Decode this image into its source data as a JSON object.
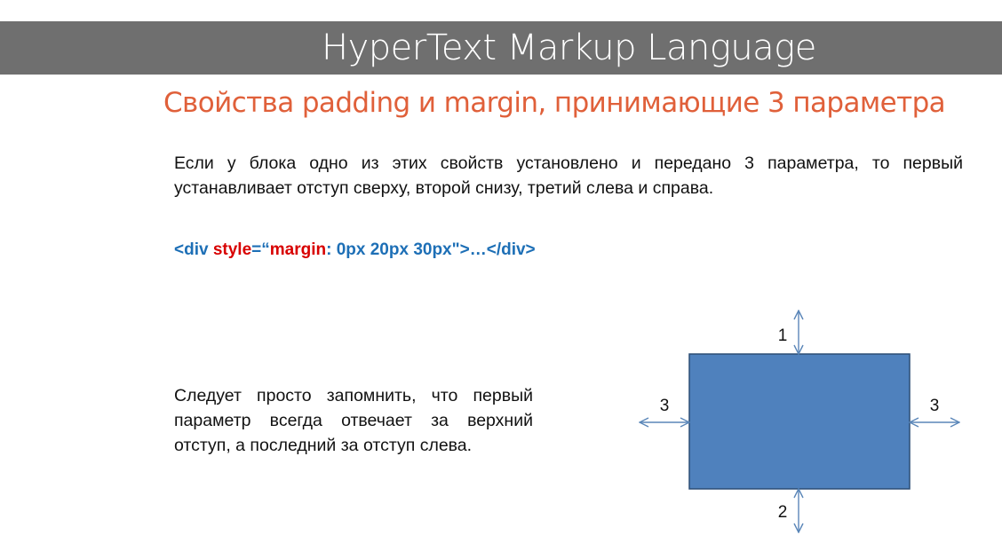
{
  "header": {
    "title": "HyperText Markup Language"
  },
  "slide": {
    "subtitle": "Свойства padding и margin, принимающие 3 параметра",
    "paragraph1": "Если у блока одно из этих свойств установлено и передано 3 параметра, то первый устанавливает отступ сверху, второй снизу, третий слева и справа.",
    "code": {
      "open_tag": "<div ",
      "attr": "style",
      "eq_quote": "=“",
      "prop": "margin",
      "value": ": 0px 20px 30px\">…</div>"
    },
    "paragraph2": "Следует просто запомнить, что первый параметр всегда отвечает за верхний отступ, а последний за отступ слева."
  },
  "diagram": {
    "label_top": "1",
    "label_bottom": "2",
    "label_left": "3",
    "label_right": "3",
    "box_color": "#4f81bd",
    "box_border_color": "#2c4d75",
    "arrow_color": "#5a86b8"
  }
}
